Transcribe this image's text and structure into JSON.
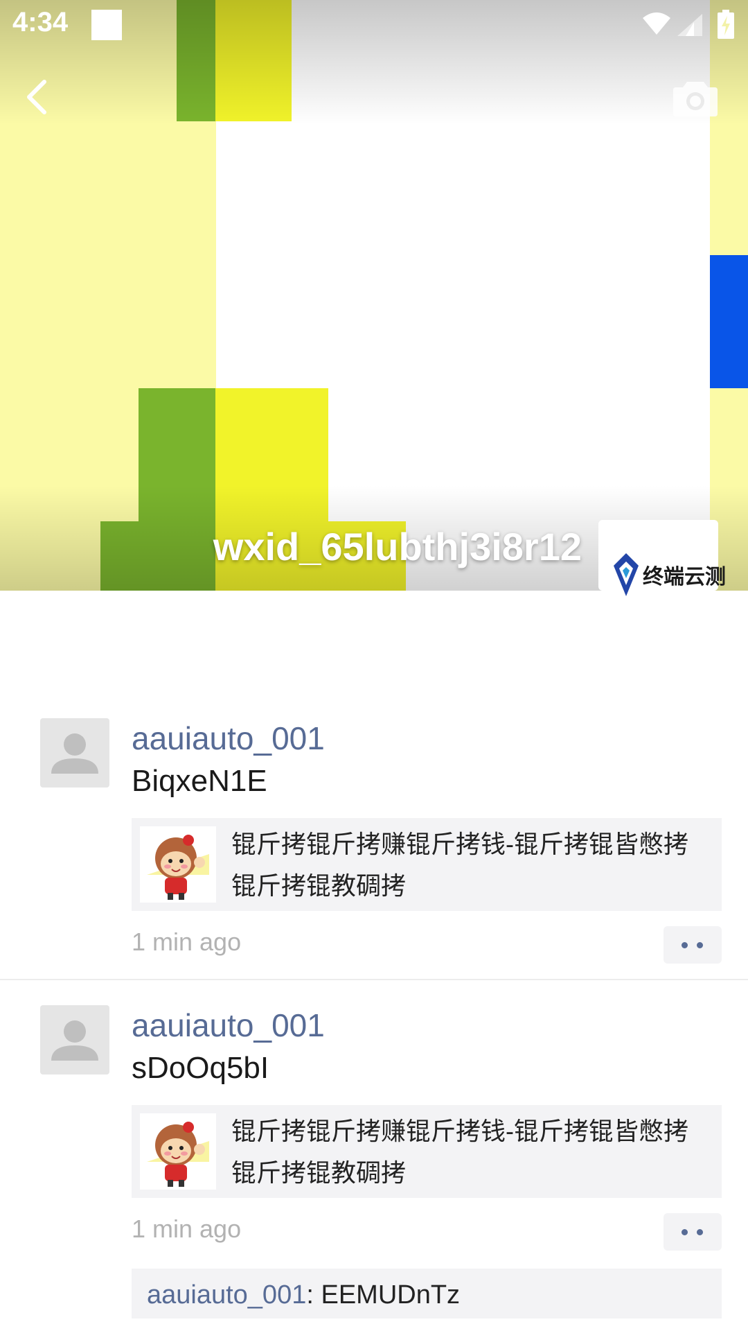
{
  "status_bar": {
    "time": "4:34"
  },
  "cover": {
    "username": "wxid_65lubthj3i8r12",
    "logo_text": "终端云测"
  },
  "posts": [
    {
      "author": "aauiauto_001",
      "text": "BiqxeN1E",
      "card_title": "锟斤拷锟斤拷赚锟斤拷钱-锟斤拷锟皆憋拷锟斤拷锟教碉拷",
      "timestamp": "1 min ago"
    },
    {
      "author": "aauiauto_001",
      "text": "sDoOq5bI",
      "card_title": "锟斤拷锟斤拷赚锟斤拷钱-锟斤拷锟皆憋拷锟斤拷锟教碉拷",
      "timestamp": "1 min ago",
      "comment": {
        "user": "aauiauto_001",
        "separator": ": ",
        "text": "EEMUDnTz"
      }
    }
  ]
}
